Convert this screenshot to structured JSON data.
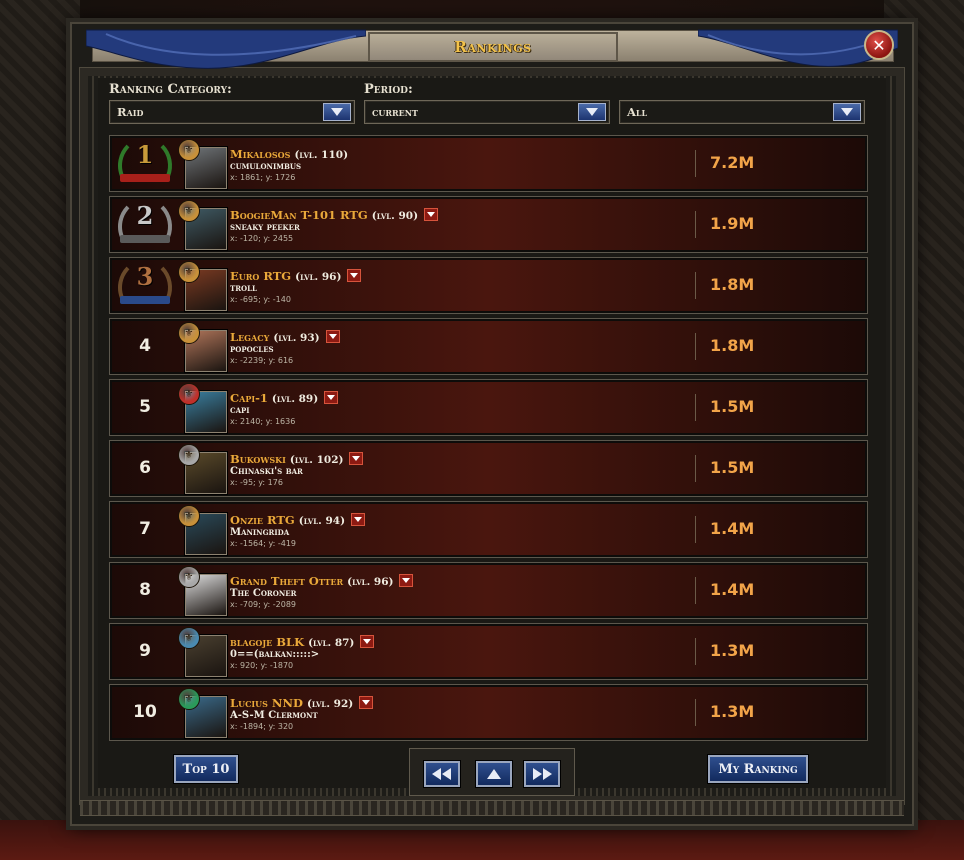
{
  "window": {
    "title": "Rankings"
  },
  "filters": {
    "category_label": "Ranking Category:",
    "category_value": "Raid",
    "period_label": "Period:",
    "period_value": "current",
    "scope_value": "All"
  },
  "rankings": [
    {
      "rank": "1",
      "name": "Mikalosos",
      "level": "(lvl. 110)",
      "city": "cumulonimbus",
      "coords": "x: 1861; y: 1726",
      "score": "7.2M",
      "has_menu": false,
      "badge_color": "#c8913a",
      "portrait_color": "#6f7478"
    },
    {
      "rank": "2",
      "name": "BoogieMan T-101 RTG",
      "level": "(lvl. 90)",
      "city": "sneaky peeker",
      "coords": "x: -120; y: 2455",
      "score": "1.9M",
      "has_menu": true,
      "badge_color": "#c8913a",
      "portrait_color": "#3f5a64"
    },
    {
      "rank": "3",
      "name": "Euro RTG",
      "level": "(lvl. 96)",
      "city": "troll",
      "coords": "x: -695; y: -140",
      "score": "1.8M",
      "has_menu": true,
      "badge_color": "#c8913a",
      "portrait_color": "#7a3a22"
    },
    {
      "rank": "4",
      "name": "Legacy",
      "level": "(lvl. 93)",
      "city": "popocles",
      "coords": "x: -2239; y: 616",
      "score": "1.8M",
      "has_menu": true,
      "badge_color": "#c8913a",
      "portrait_color": "#b0755a"
    },
    {
      "rank": "5",
      "name": "Capi-1",
      "level": "(lvl. 89)",
      "city": "capi",
      "coords": "x: 2140; y: 1636",
      "score": "1.5M",
      "has_menu": true,
      "badge_color": "#c0302a",
      "portrait_color": "#3a7fa0"
    },
    {
      "rank": "6",
      "name": "Bukowski",
      "level": "(lvl. 102)",
      "city": "Chinaski's bar",
      "coords": "x: -95; y: 176",
      "score": "1.5M",
      "has_menu": true,
      "badge_color": "#a8a8a8",
      "portrait_color": "#5a4a2a"
    },
    {
      "rank": "7",
      "name": "Onzie  RTG",
      "level": "(lvl. 94)",
      "city": "Maningrida",
      "coords": "x: -1564; y: -419",
      "score": "1.4M",
      "has_menu": true,
      "badge_color": "#c8913a",
      "portrait_color": "#2a4a5a"
    },
    {
      "rank": "8",
      "name": "Grand Theft Otter",
      "level": "(lvl. 96)",
      "city": "The Coroner",
      "coords": "x: -709; y: -2089",
      "score": "1.4M",
      "has_menu": true,
      "badge_color": "#a8a8a8",
      "portrait_color": "#dcdcdc"
    },
    {
      "rank": "9",
      "name": "blagoje BLK",
      "level": "(lvl. 87)",
      "city": "0==(balkan:::::>",
      "coords": "x: 920; y: -1870",
      "score": "1.3M",
      "has_menu": true,
      "badge_color": "#4a8ab0",
      "portrait_color": "#4a4030"
    },
    {
      "rank": "10",
      "name": "Lucius NND",
      "level": "(lvl. 92)",
      "city": "A-S-M Clermont",
      "coords": "x: -1894; y: 320",
      "score": "1.3M",
      "has_menu": true,
      "badge_color": "#2a9a5a",
      "portrait_color": "#3a6a8a"
    }
  ],
  "footer": {
    "top10_label": "Top 10",
    "my_ranking_label": "My Ranking"
  },
  "colors": {
    "accent_gold": "#eaa93a",
    "score_orange": "#f2a449",
    "button_blue": "#1d3470"
  }
}
